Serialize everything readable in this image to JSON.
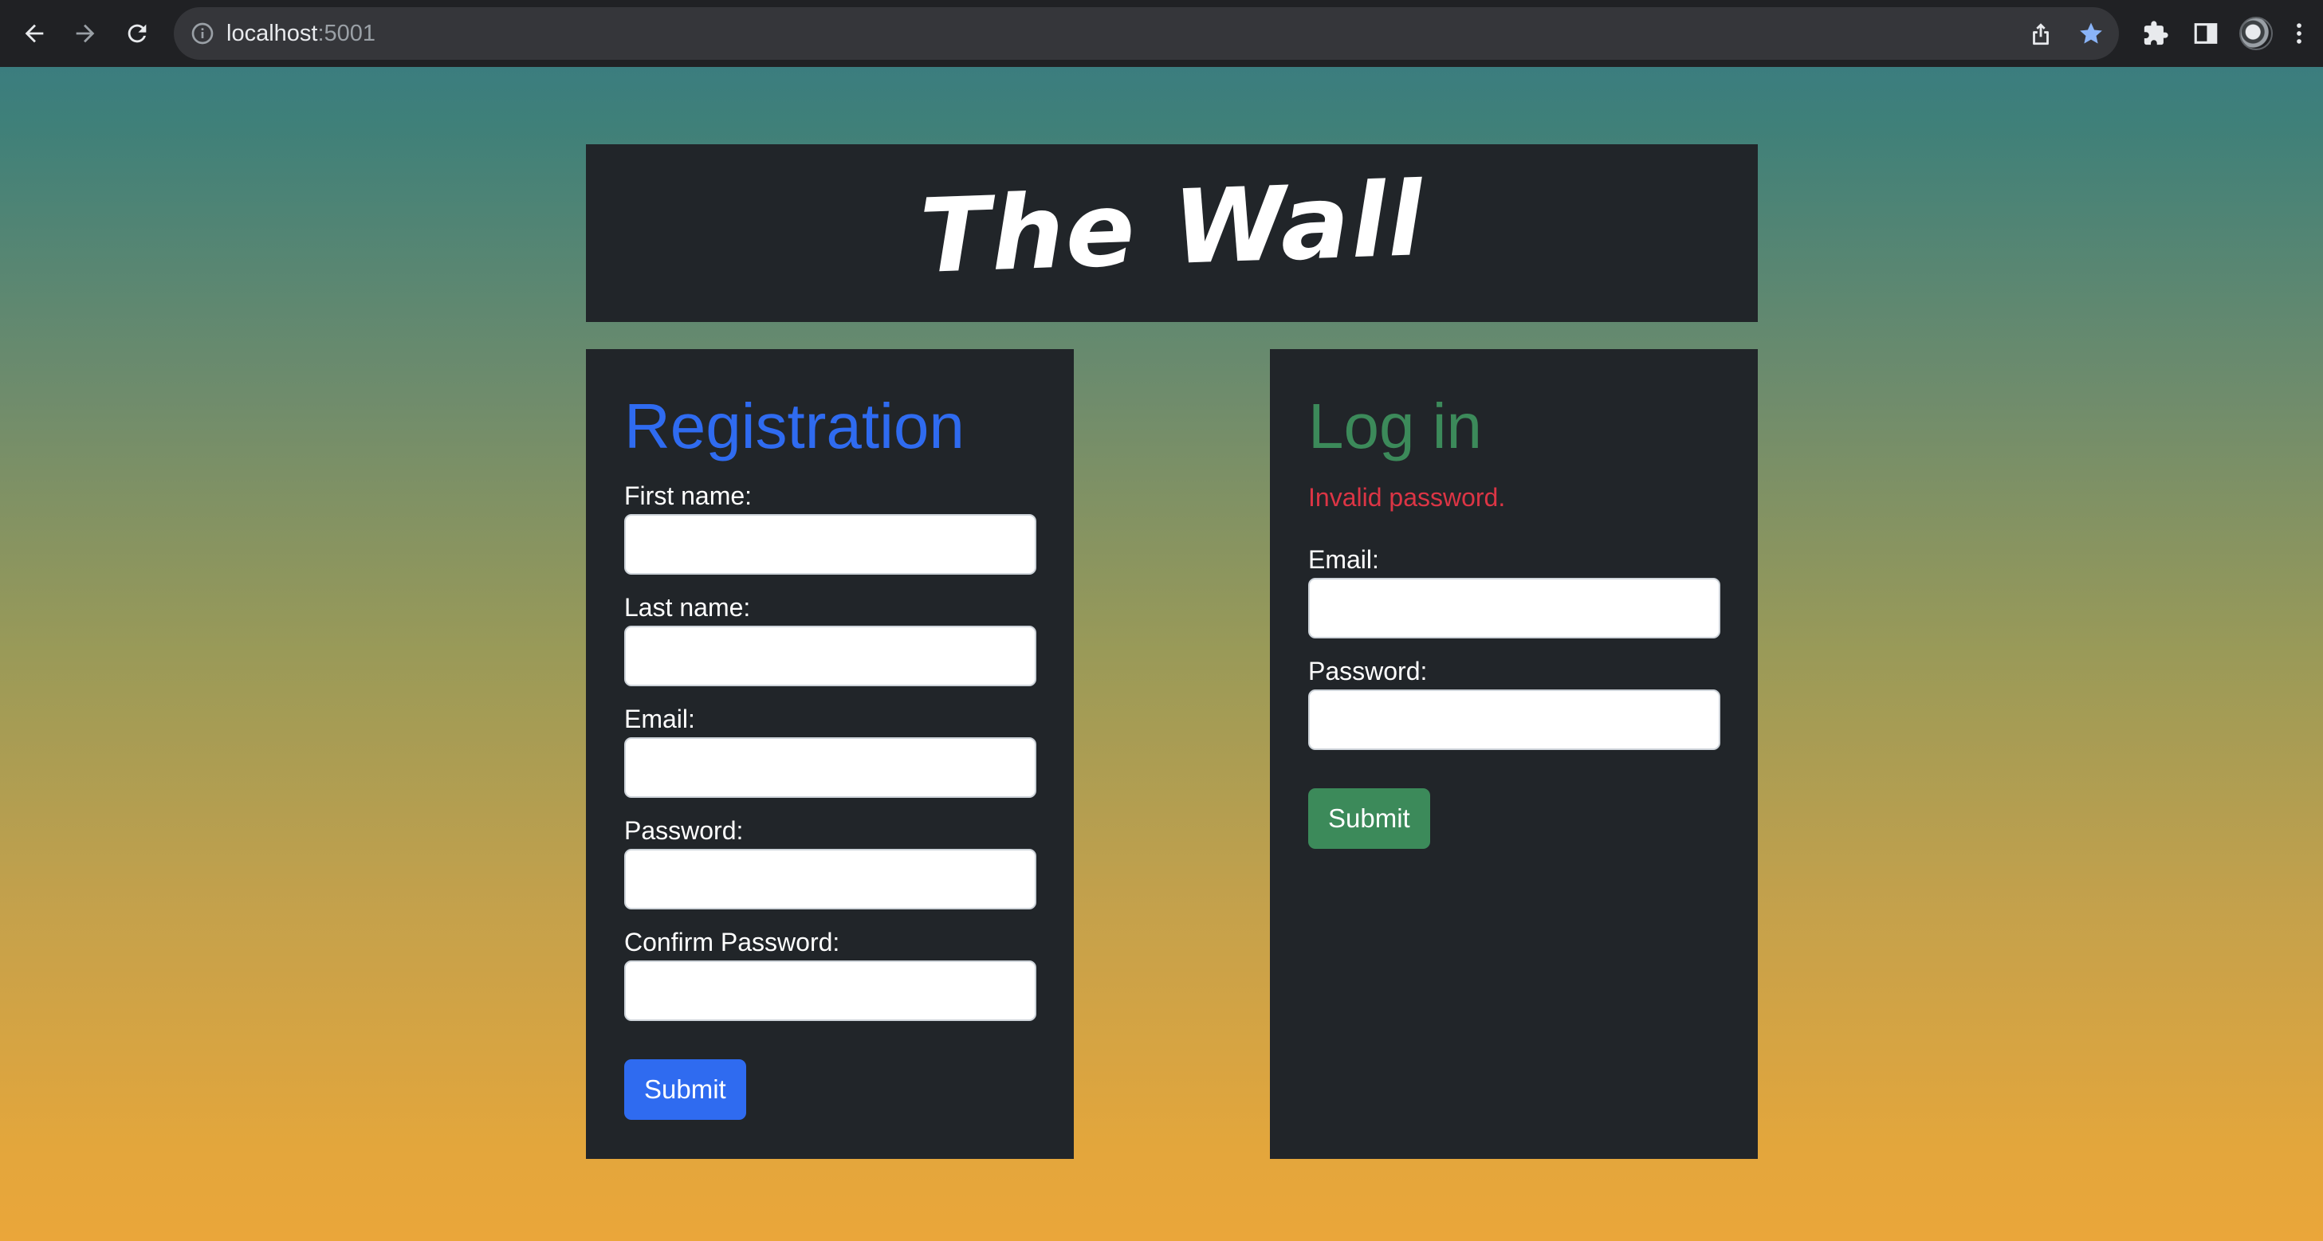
{
  "browser": {
    "url_host": "localhost",
    "url_port": ":5001",
    "icons": {
      "back": "arrow-left-icon",
      "forward": "arrow-right-icon",
      "reload": "reload-icon",
      "site_info": "info-icon",
      "share": "share-icon",
      "bookmark": "star-icon",
      "extensions": "puzzle-icon",
      "side_panel": "side-panel-icon",
      "profile": "avatar-icon",
      "menu": "kebab-menu-icon"
    },
    "colors": {
      "bookmark_star": "#8ab4f8",
      "chrome_bg": "#202124"
    }
  },
  "header": {
    "title": "The Wall"
  },
  "registration": {
    "heading": "Registration",
    "fields": [
      {
        "label": "First name:",
        "value": ""
      },
      {
        "label": "Last name:",
        "value": ""
      },
      {
        "label": "Email:",
        "value": ""
      },
      {
        "label": "Password:",
        "value": ""
      },
      {
        "label": "Confirm Password:",
        "value": ""
      }
    ],
    "submit_label": "Submit",
    "accent_color": "#2f6bf0"
  },
  "login": {
    "heading": "Log in",
    "error": "Invalid password.",
    "fields": [
      {
        "label": "Email:",
        "value": ""
      },
      {
        "label": "Password:",
        "value": ""
      }
    ],
    "submit_label": "Submit",
    "accent_color": "#3c8a5a",
    "error_color": "#dc3545"
  }
}
